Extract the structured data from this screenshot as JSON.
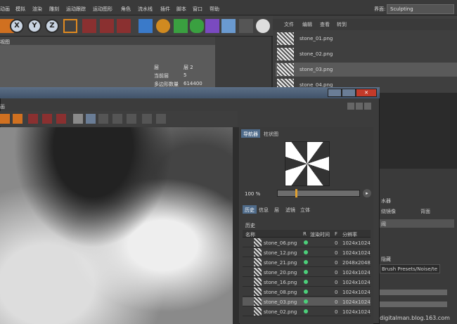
{
  "menubar": {
    "items": [
      "动画",
      "模拟",
      "渲染",
      "雕刻",
      "运动跟踪",
      "运动图形",
      "角色",
      "流水线",
      "插件",
      "脚本",
      "窗口",
      "帮助"
    ],
    "layout_label": "界面:",
    "layout_value": "Sculpting"
  },
  "toolbar": {
    "x": "X",
    "y": "Y",
    "z": "Z"
  },
  "viewport": {
    "corner": "视图",
    "info": [
      {
        "label": "层",
        "value": "层 2"
      },
      {
        "label": "当前层",
        "value": "5"
      },
      {
        "label": "多边形数量",
        "value": "614400"
      }
    ]
  },
  "file_browser": {
    "menus": [
      "文件",
      "编辑",
      "查看",
      "转到"
    ],
    "files": [
      "stone_01.png",
      "stone_02.png",
      "stone_03.png",
      "stone_04.png"
    ],
    "selected_index": 2
  },
  "picture_viewer": {
    "corner": "画",
    "nav_tabs": [
      "导航器",
      "柱状图"
    ],
    "zoom": "100 %",
    "zoom_fraction": 0.22,
    "tabs": [
      "历史",
      "信息",
      "层",
      "滤镜",
      "立体"
    ],
    "history_label": "历史",
    "columns": {
      "name": "名称",
      "r": "R",
      "time": "渲染时间",
      "f": "F",
      "res": "分辨率"
    },
    "rows": [
      {
        "name": "stone_06.png",
        "f": "0",
        "res": "1024x1024"
      },
      {
        "name": "stone_12.png",
        "f": "0",
        "res": "1024x1024"
      },
      {
        "name": "stone_21.png",
        "f": "0",
        "res": "2048x2048"
      },
      {
        "name": "stone_20.png",
        "f": "0",
        "res": "1024x1024"
      },
      {
        "name": "stone_16.png",
        "f": "0",
        "res": "1024x1024"
      },
      {
        "name": "stone_08.png",
        "f": "0",
        "res": "1024x1024"
      },
      {
        "name": "stone_03.png",
        "f": "0",
        "res": "1024x1024"
      },
      {
        "name": "stone_02.png",
        "f": "0",
        "res": "1024x1024"
      }
    ],
    "selected_row": 6
  },
  "right_panel": {
    "field1": "水器",
    "field2": "绕镜像",
    "field3": "背面",
    "field4": "阈",
    "field5": "隐藏",
    "path": "Brush Presets/Noise/te"
  },
  "watermark": "digitalman.blog.163.com"
}
